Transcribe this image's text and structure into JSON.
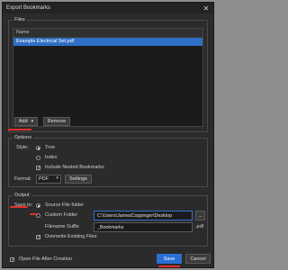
{
  "window": {
    "title": "Export Bookmarks",
    "close_glyph": "✕"
  },
  "files": {
    "legend": "Files",
    "column_header": "Name",
    "items": [
      "Example Electrical Set.pdf"
    ],
    "add_label": "Add",
    "add_chevron": "▾",
    "remove_label": "Remove"
  },
  "options": {
    "legend": "Options",
    "style_label": "Style:",
    "style_tree": "Tree",
    "style_index": "Index",
    "include_nested": "Include Nested Bookmarks",
    "format_label": "Format:",
    "format_value": "PDF",
    "format_chevron": "▾",
    "settings_label": "Settings"
  },
  "output": {
    "legend": "Output",
    "save_to_label": "Save to:",
    "source_file_folder": "Source File folder",
    "custom_folder": "Custom Folder",
    "custom_folder_path": "C:\\Users\\JamesCoppinger\\Desktop",
    "browse_label": "...",
    "filename_suffix_label": "Filename Suffix",
    "filename_suffix_value": "_Bookmarks",
    "extension": ".pdf",
    "overwrite_existing": "Overwrite Existing Files"
  },
  "footer": {
    "open_after_creation": "Open File After Creation",
    "save_label": "Save",
    "cancel_label": "Cancel"
  },
  "colors": {
    "accent": "#2a6fd6",
    "annotation": "#e2302b"
  }
}
